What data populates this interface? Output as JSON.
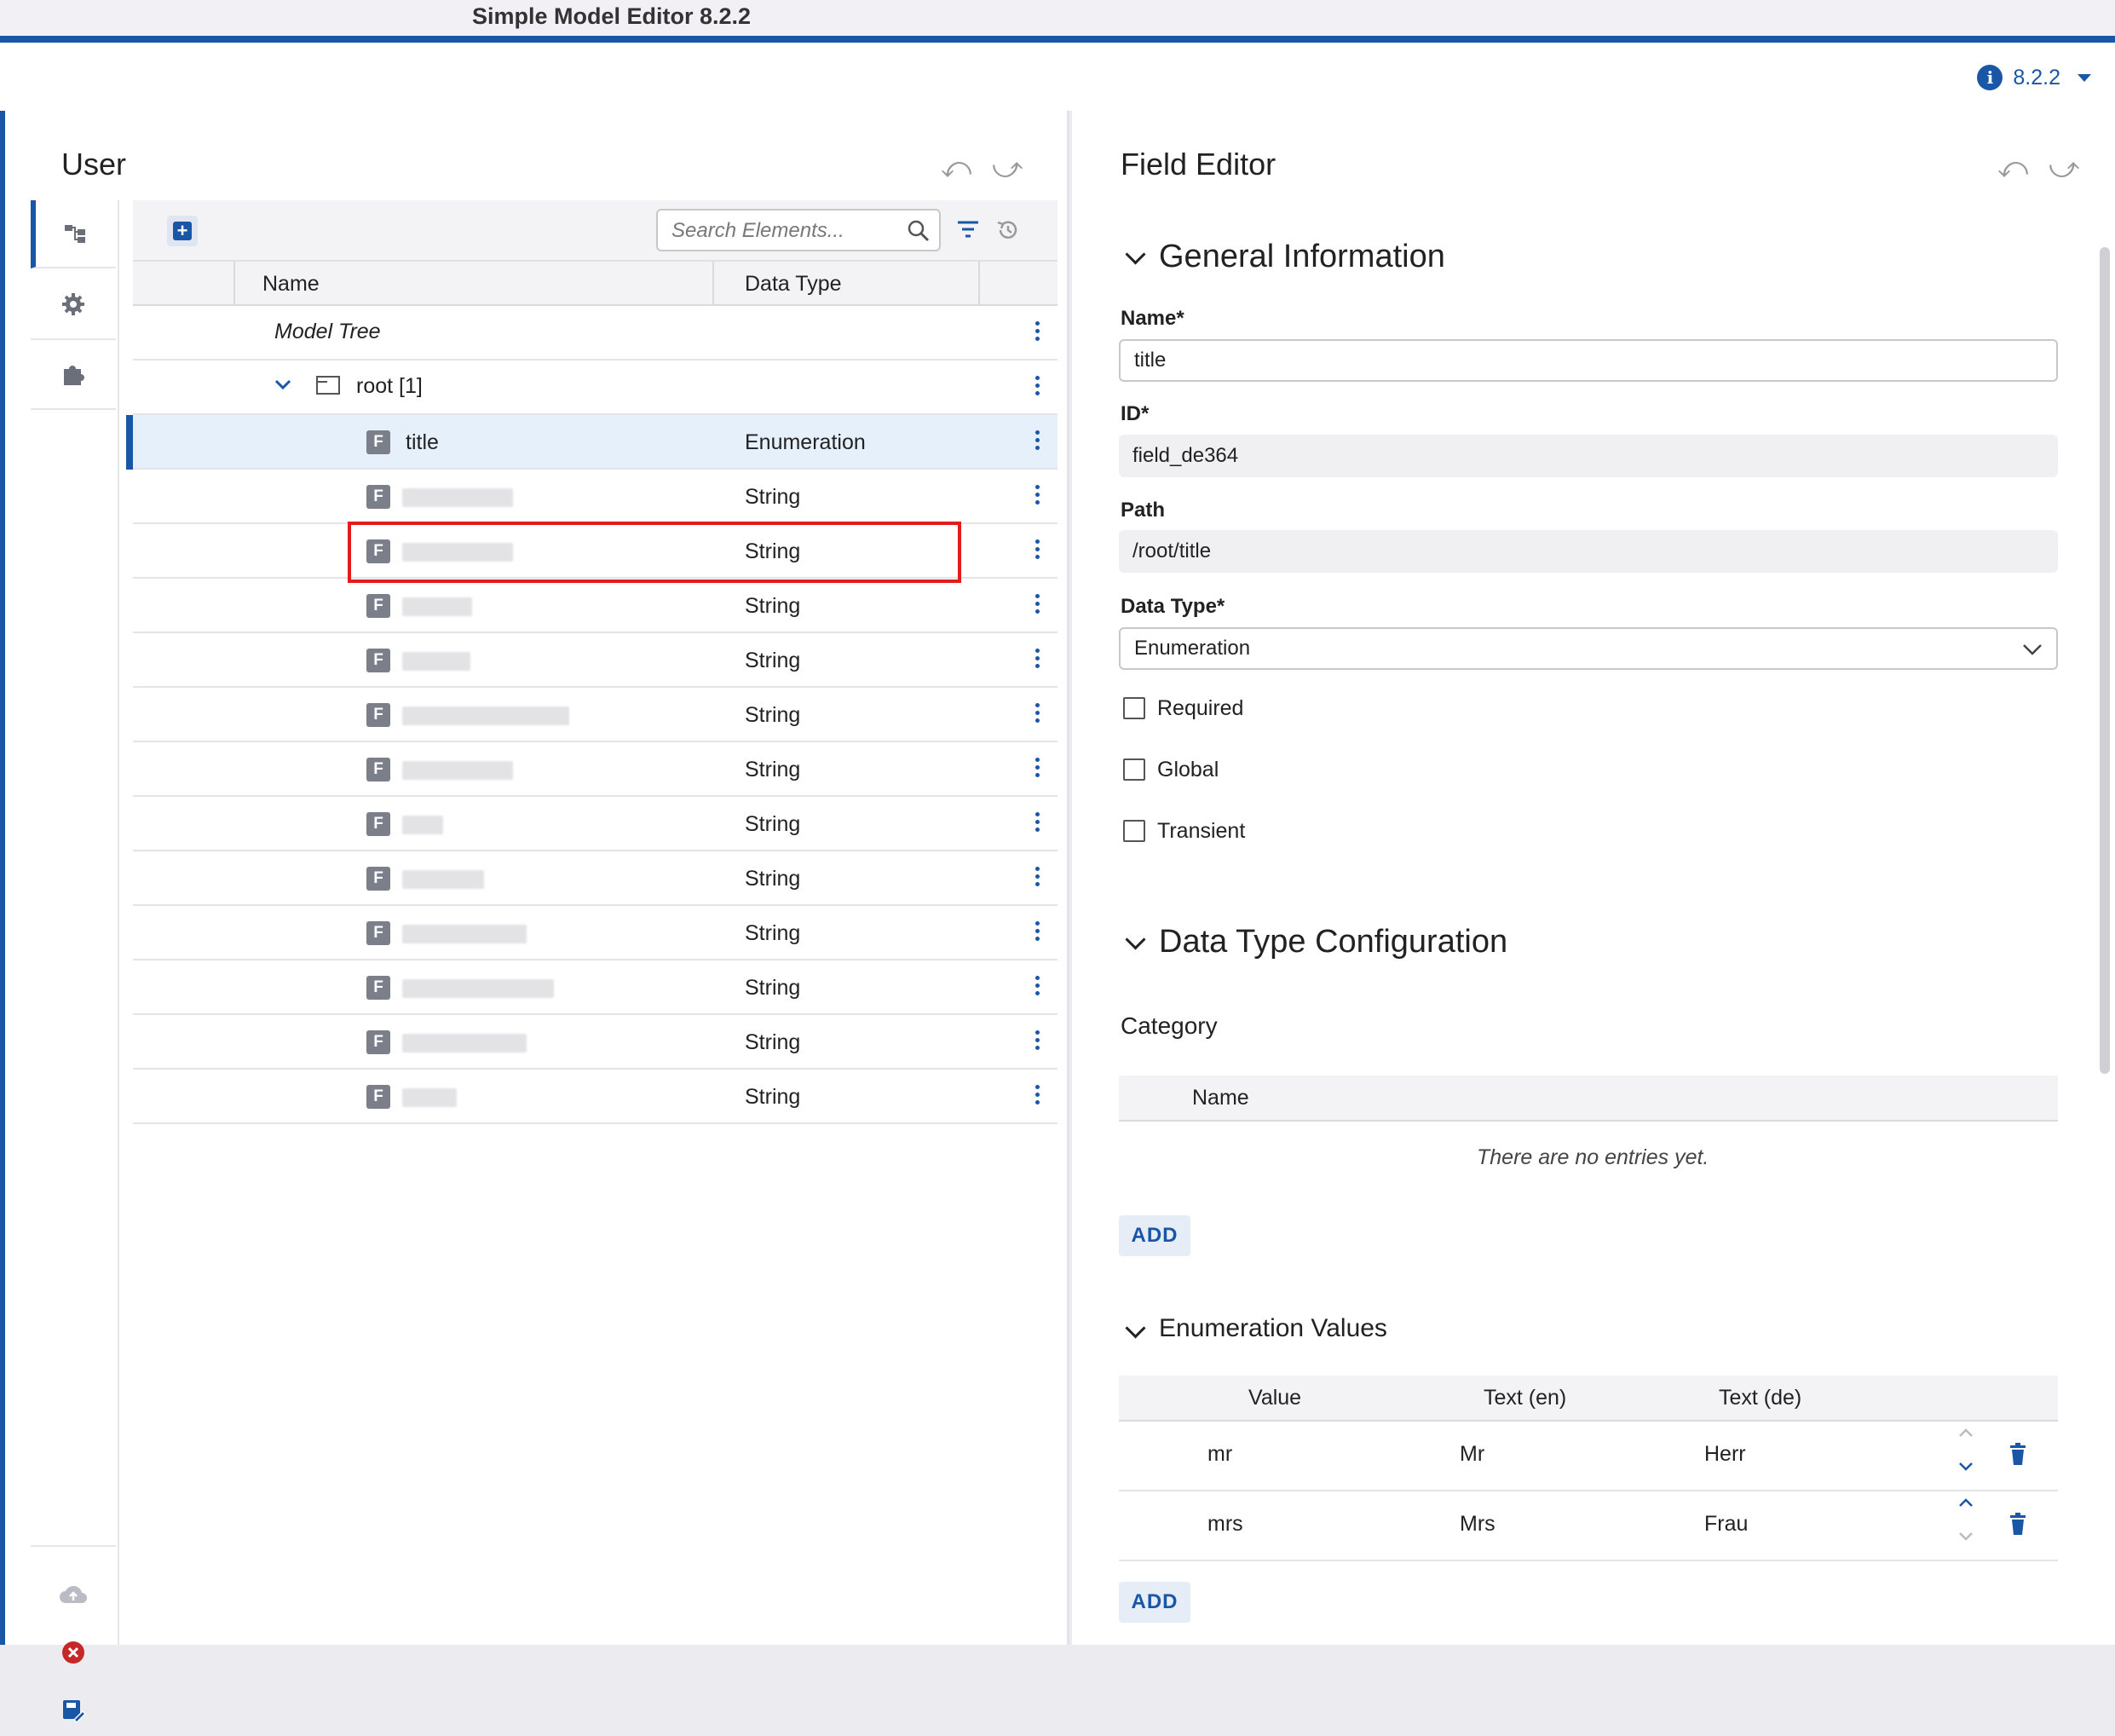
{
  "app": {
    "title": "Simple Model Editor 8.2.2",
    "version": "8.2.2"
  },
  "left": {
    "title": "User",
    "search_placeholder": "Search Elements...",
    "columns": {
      "name": "Name",
      "data_type": "Data Type"
    },
    "model_tree_label": "Model Tree",
    "root_label": "root [1]",
    "field_icon_letter": "F",
    "rows": [
      {
        "name": "title",
        "type": "Enumeration"
      },
      {
        "name": "",
        "type": "String"
      },
      {
        "name": "",
        "type": "String"
      },
      {
        "name": "",
        "type": "String"
      },
      {
        "name": "",
        "type": "String"
      },
      {
        "name": "",
        "type": "String"
      },
      {
        "name": "",
        "type": "String"
      },
      {
        "name": "",
        "type": "String"
      },
      {
        "name": "",
        "type": "String"
      },
      {
        "name": "",
        "type": "String"
      },
      {
        "name": "",
        "type": "String"
      },
      {
        "name": "",
        "type": "String"
      },
      {
        "name": "",
        "type": "String"
      }
    ]
  },
  "right": {
    "title": "Field Editor",
    "general": {
      "heading": "General Information",
      "name_label": "Name*",
      "name_value": "title",
      "id_label": "ID*",
      "id_value": "field_de364",
      "path_label": "Path",
      "path_value": "/root/title",
      "type_label": "Data Type*",
      "type_value": "Enumeration",
      "required_label": "Required",
      "global_label": "Global",
      "transient_label": "Transient"
    },
    "config": {
      "heading": "Data Type Configuration",
      "category_label": "Category",
      "category_col_name": "Name",
      "empty_text": "There are no entries yet.",
      "add_label": "ADD"
    },
    "enum": {
      "heading": "Enumeration Values",
      "col_value": "Value",
      "col_en": "Text (en)",
      "col_de": "Text (de)",
      "rows": [
        {
          "value": "mr",
          "en": "Mr",
          "de": "Herr"
        },
        {
          "value": "mrs",
          "en": "Mrs",
          "de": "Frau"
        }
      ],
      "add_label": "ADD"
    }
  },
  "colors": {
    "accent": "#1a56a6",
    "highlight": "#e51b1b",
    "danger": "#c62828"
  }
}
